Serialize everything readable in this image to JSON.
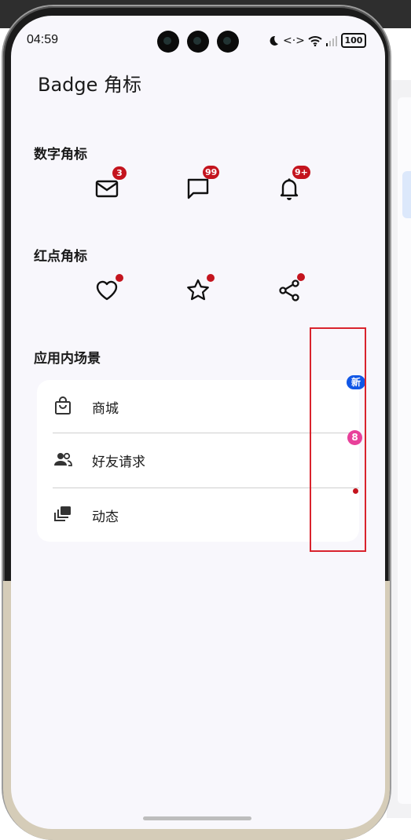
{
  "status_bar": {
    "time": "04:59",
    "moon_icon": "moon-icon",
    "signal_glyph": "<·>",
    "battery": "100"
  },
  "page": {
    "title": "Badge 角标"
  },
  "sections": {
    "number_badges": {
      "title": "数字角标",
      "items": [
        {
          "icon": "mail-icon",
          "badge": "3"
        },
        {
          "icon": "chat-icon",
          "badge": "99"
        },
        {
          "icon": "bell-icon",
          "badge": "9+"
        }
      ]
    },
    "dot_badges": {
      "title": "红点角标",
      "items": [
        {
          "icon": "heart-icon"
        },
        {
          "icon": "star-icon"
        },
        {
          "icon": "share-icon"
        }
      ]
    },
    "in_app": {
      "title": "应用内场景",
      "rows": [
        {
          "icon": "shopping-bag-icon",
          "label": "商城",
          "badge": "新"
        },
        {
          "icon": "people-icon",
          "label": "好友请求",
          "badge": "8"
        },
        {
          "icon": "stack-icon",
          "label": "动态",
          "badge": ""
        }
      ]
    }
  },
  "colors": {
    "badge_red": "#c4141e",
    "badge_blue": "#1157e6",
    "badge_pink": "#e8409a",
    "highlight": "#d9232d"
  }
}
